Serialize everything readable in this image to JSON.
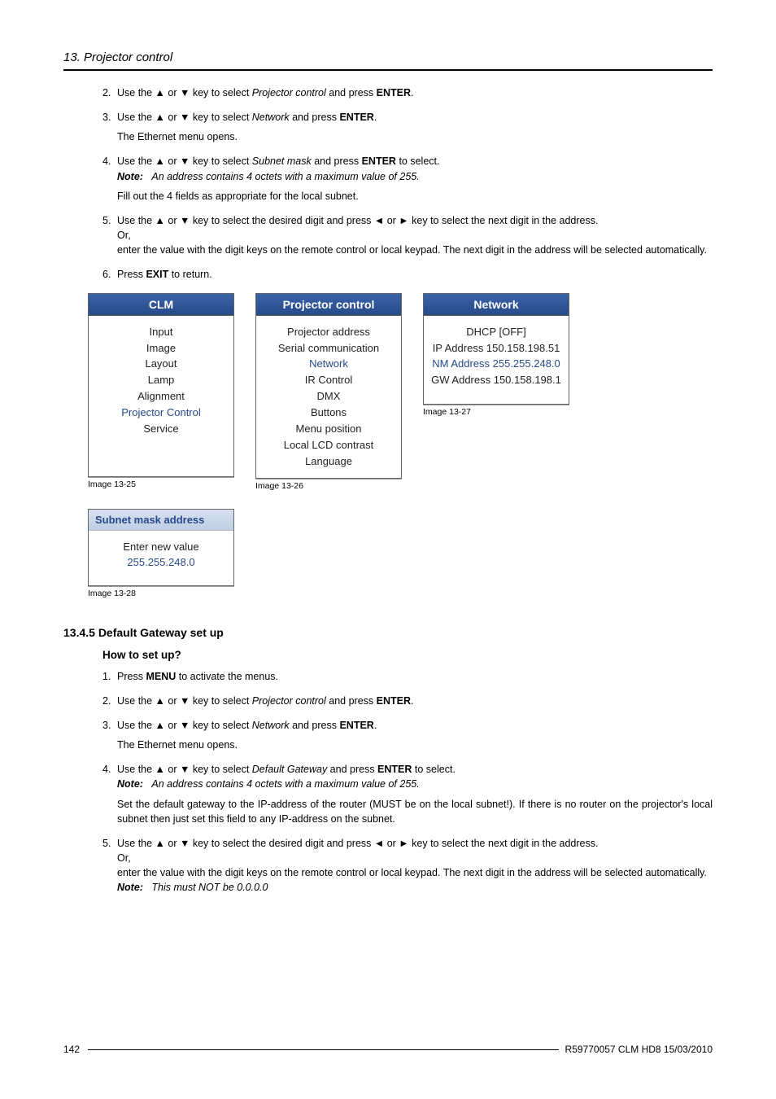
{
  "header": {
    "running_head": "13.  Projector control"
  },
  "steps_a": {
    "s2": {
      "num": "2.",
      "pre": "Use the ▲ or ▼ key to select ",
      "em": "Projector control",
      "post": " and press ",
      "enter": "ENTER",
      "end": "."
    },
    "s3": {
      "num": "3.",
      "pre": "Use the ▲ or ▼ key to select ",
      "em": "Network",
      "post": " and press ",
      "enter": "ENTER",
      "end": ".",
      "sub": "The Ethernet menu opens."
    },
    "s4": {
      "num": "4.",
      "pre": "Use the ▲ or ▼ key to select ",
      "em": "Subnet mask",
      "post": " and press ",
      "enter": "ENTER",
      "end": " to select.",
      "note_label": "Note:",
      "note_text": "An address contains 4 octets with a maximum value of 255.",
      "sub": "Fill out the 4 fields as appropriate for the local subnet."
    },
    "s5": {
      "num": "5.",
      "line1": "Use the ▲ or ▼ key to select the desired digit and press ◄ or ► key to select the next digit in the address.",
      "or": "Or,",
      "line2": "enter the value with the digit keys on the remote control or local keypad. The next digit in the address will be selected automatically."
    },
    "s6": {
      "num": "6.",
      "pre": "Press ",
      "exit": "EXIT",
      "end": " to return."
    }
  },
  "fig25": {
    "caption": "Image 13-25",
    "title": "CLM",
    "items": [
      "Input",
      "Image",
      "Layout",
      "Lamp",
      "Alignment",
      "Projector Control",
      "Service"
    ],
    "highlight_index": 5
  },
  "fig26": {
    "caption": "Image 13-26",
    "title": "Projector control",
    "items": [
      "Projector address",
      "Serial communication",
      "Network",
      "IR Control",
      "DMX",
      "Buttons",
      "Menu position",
      "Local LCD contrast",
      "Language"
    ],
    "highlight_index": 2
  },
  "fig27": {
    "caption": "Image 13-27",
    "title": "Network",
    "items": [
      "DHCP [OFF]",
      "IP Address 150.158.198.51",
      "NM Address 255.255.248.0",
      "GW Address 150.158.198.1"
    ],
    "highlight_index": 2
  },
  "fig28": {
    "caption": "Image 13-28",
    "title": "Subnet mask address",
    "line1": "Enter new value",
    "line2": "255.255.248.0"
  },
  "section_b": {
    "heading": "13.4.5    Default Gateway set up",
    "sub_head": "How to set up?"
  },
  "steps_b": {
    "s1": {
      "num": "1.",
      "pre": "Press ",
      "menu": "MENU",
      "end": " to activate the menus."
    },
    "s2": {
      "num": "2.",
      "pre": "Use the ▲ or ▼ key to select ",
      "em": "Projector control",
      "post": " and press ",
      "enter": "ENTER",
      "end": "."
    },
    "s3": {
      "num": "3.",
      "pre": "Use the ▲ or ▼ key to select ",
      "em": "Network",
      "post": " and press ",
      "enter": "ENTER",
      "end": ".",
      "sub": "The Ethernet menu opens."
    },
    "s4": {
      "num": "4.",
      "pre": "Use the ▲ or ▼ key to select ",
      "em": "Default Gateway",
      "post": " and press ",
      "enter": "ENTER",
      "end": " to select.",
      "note_label": "Note:",
      "note_text": "An address contains 4 octets with a maximum value of 255.",
      "sub": "Set the default gateway to the IP-address of the router (MUST be on the local subnet!).  If there is no router on the projector's local subnet then just set this field to any IP-address on the subnet."
    },
    "s5": {
      "num": "5.",
      "line1": "Use the ▲ or ▼ key to select the desired digit and press ◄ or ► key to select the next digit in the address.",
      "or": "Or,",
      "line2": "enter the value with the digit keys on the remote control or local keypad. The next digit in the address will be selected automatically.",
      "note_label": "Note:",
      "note_text": "This must NOT be 0.0.0.0"
    }
  },
  "footer": {
    "page": "142",
    "doc": "R59770057  CLM HD8  15/03/2010"
  }
}
